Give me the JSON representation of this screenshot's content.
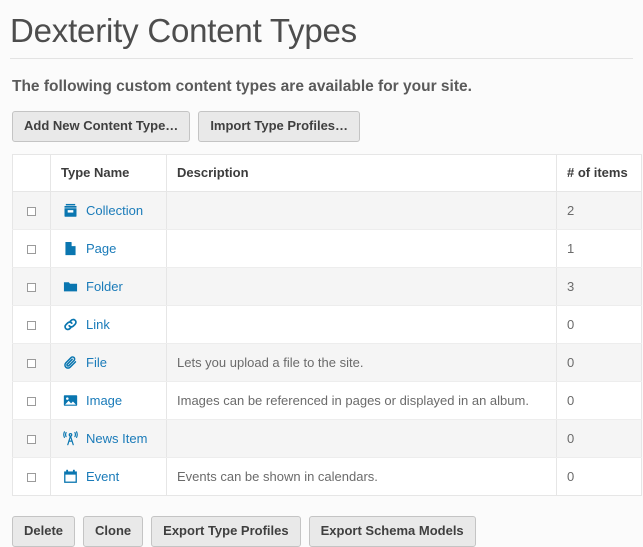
{
  "page": {
    "title": "Dexterity Content Types",
    "lead": "The following custom content types are available for your site."
  },
  "toolbar_top": {
    "add_new_label": "Add New Content Type…",
    "import_label": "Import Type Profiles…"
  },
  "table": {
    "columns": {
      "select": "",
      "type_name": "Type Name",
      "description": "Description",
      "count": "# of items"
    },
    "rows": [
      {
        "icon": "collection-icon",
        "name": "Collection",
        "description": "",
        "count": "2",
        "checked": false
      },
      {
        "icon": "page-icon",
        "name": "Page",
        "description": "",
        "count": "1",
        "checked": false
      },
      {
        "icon": "folder-icon",
        "name": "Folder",
        "description": "",
        "count": "3",
        "checked": false
      },
      {
        "icon": "link-icon",
        "name": "Link",
        "description": "",
        "count": "0",
        "checked": false
      },
      {
        "icon": "paperclip-icon",
        "name": "File",
        "description": "Lets you upload a file to the site.",
        "count": "0",
        "checked": false
      },
      {
        "icon": "image-icon",
        "name": "Image",
        "description": "Images can be referenced in pages or displayed in an album.",
        "count": "0",
        "checked": false
      },
      {
        "icon": "broadcast-tower-icon",
        "name": "News Item",
        "description": "",
        "count": "0",
        "checked": false
      },
      {
        "icon": "calendar-icon",
        "name": "Event",
        "description": "Events can be shown in calendars.",
        "count": "0",
        "checked": false
      }
    ]
  },
  "toolbar_bottom": {
    "delete_label": "Delete",
    "clone_label": "Clone",
    "export_type_profiles_label": "Export Type Profiles",
    "export_schema_models_label": "Export Schema Models"
  },
  "colors": {
    "link": "#1a7bb9",
    "icon": "#0a76b0",
    "title": "#4d4d4d",
    "row_stripe": "#f5f5f5",
    "button_bg": "#e9e9e9",
    "border": "#e6e6e6"
  }
}
